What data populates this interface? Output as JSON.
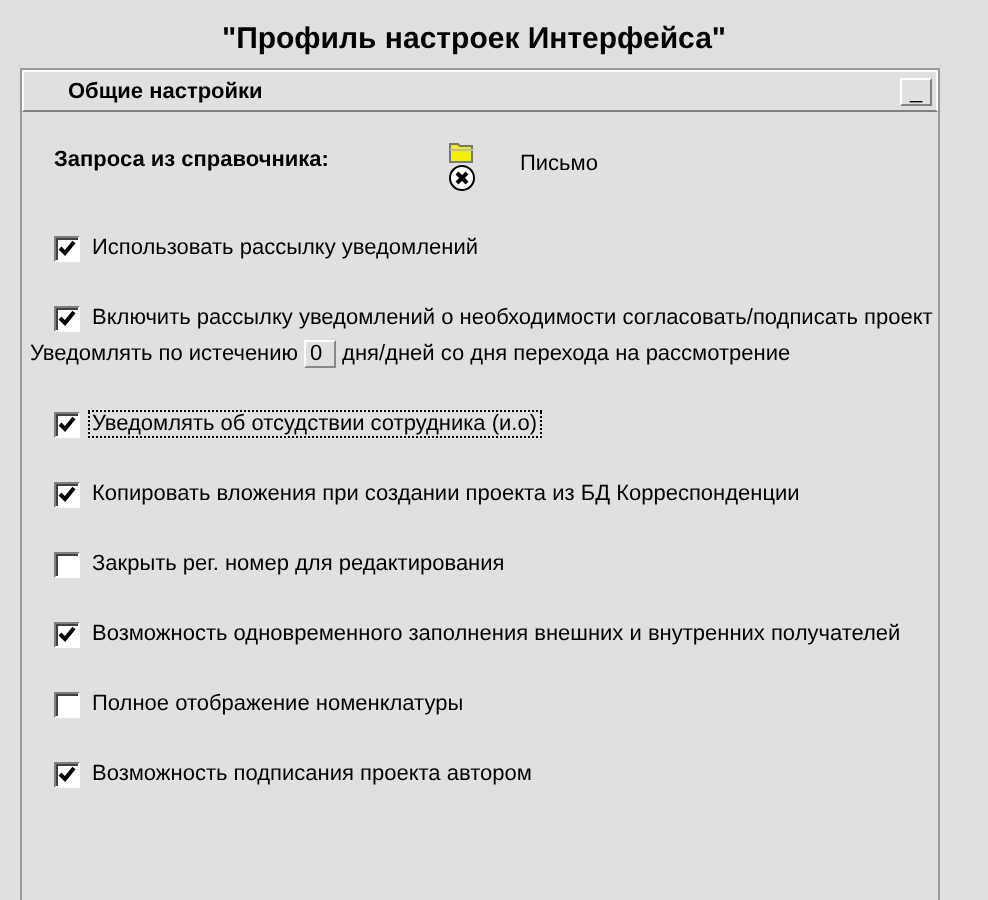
{
  "title": "\"Профиль настроек Интерфейса\"",
  "panel": {
    "title": "Общие настройки",
    "minimize_button": "_"
  },
  "lookup": {
    "label": "Запроса из справочника:",
    "value": "Письмо"
  },
  "options": [
    {
      "kind": "checkbox",
      "label": "Использовать рассылку уведомлений",
      "checked": true,
      "focused": false
    },
    {
      "kind": "checkbox",
      "label": "Включить рассылку уведомлений о необходимости согласовать/подписать проект",
      "checked": true,
      "focused": false,
      "delay": {
        "prefix": "Уведомлять по истечению",
        "value": "0",
        "suffix": "дня/дней со дня перехода на рассмотрение"
      }
    },
    {
      "kind": "checkbox",
      "label": "Уведомлять об отсудствии сотрудника (и.о)",
      "checked": true,
      "focused": true
    },
    {
      "kind": "checkbox",
      "label": "Копировать вложения при создании проекта из БД Корреспонденции",
      "checked": true,
      "focused": false
    },
    {
      "kind": "checkbox",
      "label": "Закрыть рег. номер для редактирования",
      "checked": false,
      "focused": false
    },
    {
      "kind": "checkbox",
      "label": "Возможность одновременного заполнения внешних и внутренних получателей",
      "checked": true,
      "focused": false
    },
    {
      "kind": "checkbox",
      "label": "Полное отображение номенклатуры",
      "checked": false,
      "focused": false
    },
    {
      "kind": "checkbox",
      "label": "Возможность подписания проекта автором",
      "checked": true,
      "focused": false
    }
  ]
}
